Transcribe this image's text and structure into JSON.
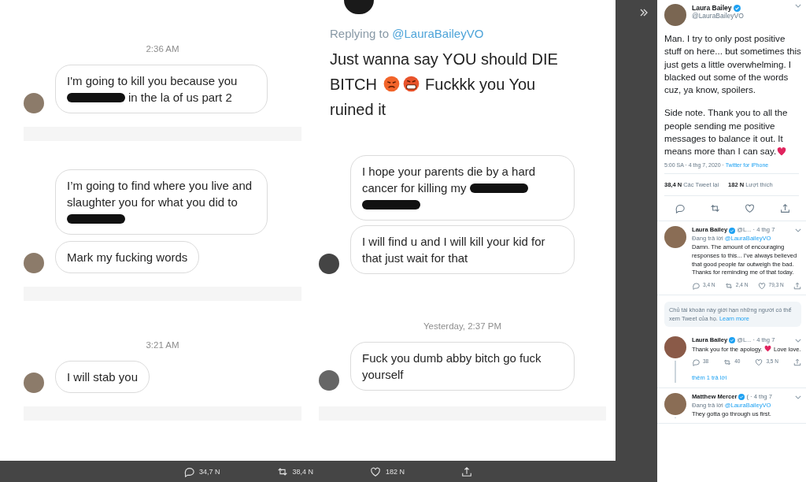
{
  "image": {
    "left_thread": [
      {
        "kind": "time",
        "text": "2:36 AM"
      },
      {
        "kind": "message",
        "avatar": true,
        "segments": [
          {
            "kind": "text",
            "text": "I'm going to kill you because you "
          },
          {
            "kind": "redacted"
          },
          {
            "kind": "text",
            "text": "in the la of us part 2"
          }
        ]
      },
      {
        "kind": "divider"
      },
      {
        "kind": "message",
        "avatar": false,
        "segments": [
          {
            "kind": "text",
            "text": "I’m going to find where you live and slaughter you for what you did to "
          },
          {
            "kind": "redacted"
          }
        ]
      },
      {
        "kind": "message",
        "avatar": true,
        "segments": [
          {
            "kind": "text",
            "text": "Mark my fucking words"
          }
        ]
      },
      {
        "kind": "divider"
      },
      {
        "kind": "time",
        "text": "3:21 AM"
      },
      {
        "kind": "message",
        "avatar": true,
        "segments": [
          {
            "kind": "text",
            "text": "I will stab you"
          }
        ]
      },
      {
        "kind": "divider"
      }
    ],
    "right_thread": [
      {
        "kind": "reply_header",
        "prefix": "Replying to",
        "handle": "@LauraBaileyVO"
      },
      {
        "kind": "tweet_text",
        "segments": [
          {
            "kind": "text",
            "text": "Just wanna say YOU should DIE BITCH "
          },
          {
            "kind": "angry-emoji"
          },
          {
            "kind": "cursing-emoji"
          },
          {
            "kind": "text",
            "text": " Fuckkk you You ruined it"
          }
        ]
      },
      {
        "kind": "message",
        "avatar": false,
        "segments": [
          {
            "kind": "text",
            "text": "I hope your parents die by a hard cancer for killing my "
          },
          {
            "kind": "redacted"
          },
          {
            "kind": "redacted"
          }
        ]
      },
      {
        "kind": "message",
        "avatar": true,
        "segments": [
          {
            "kind": "text",
            "text": "I will find u and I will kill your kid for that just wait for that"
          }
        ]
      },
      {
        "kind": "time",
        "text": "Yesterday, 2:37 PM"
      },
      {
        "kind": "message",
        "avatar": true,
        "segments": [
          {
            "kind": "text",
            "text": "Fuck you dumb abby bitch go fuck yourself"
          }
        ]
      },
      {
        "kind": "divider"
      }
    ]
  },
  "action_bar": [
    {
      "kind": "reply",
      "count": "34,7 N"
    },
    {
      "kind": "retweet",
      "count": "38,4 N"
    },
    {
      "kind": "like",
      "count": "182 N"
    },
    {
      "kind": "share"
    }
  ],
  "side_panel": {
    "main_tweet": {
      "name": "Laura Bailey",
      "verified": true,
      "handle": "@LauraBaileyVO",
      "segments": [
        {
          "kind": "text",
          "text": "Man. I try to only post positive stuff on here... but sometimes this just gets a little overwhelming. I blacked out some of the words cuz, ya know, spoilers."
        },
        {
          "kind": "break"
        },
        {
          "kind": "text",
          "text": "Side note. Thank you to all the people sending me positive messages to balance it out. It means more than I can say."
        },
        {
          "kind": "heart-emoji"
        }
      ],
      "meta": "5:00 SA · 4 thg 7, 2020 · ",
      "source": "Twitter for iPhone",
      "stats": [
        {
          "count": "38,4 N",
          "label": "Các Tweet lại"
        },
        {
          "count": "182 N",
          "label": "Lượt thích"
        }
      ]
    },
    "replies": [
      {
        "kind": "reply",
        "name": "Laura Bailey",
        "verified": true,
        "handle": "@L...",
        "date": "· 4 thg 7",
        "replying_prefix": "Đang trả lời",
        "replying_handle": "@LauraBaileyVO",
        "thread_line": false,
        "segments": [
          {
            "kind": "text",
            "text": "Damn. The amount of encouraging responses to this... I've always believed that good people far outweigh the bad. Thanks for reminding me of that today."
          }
        ],
        "counts": [
          "3,4 N",
          "2,4 N",
          "79,3 N"
        ]
      },
      {
        "kind": "notice",
        "text": "Chủ tài khoản này giới hạn những người có thể xem Tweet của họ.",
        "link": "Learn more"
      },
      {
        "kind": "reply",
        "name": "Laura Bailey",
        "verified": true,
        "handle": "@L...",
        "date": "· 4 thg 7",
        "thread_line": true,
        "segments": [
          {
            "kind": "text",
            "text": "Thank you for the apology. "
          },
          {
            "kind": "heart-emoji"
          },
          {
            "kind": "text",
            "text": " Love love."
          }
        ],
        "counts": [
          "38",
          "40",
          "3,5 N"
        ],
        "more": "thêm 1 trả lời"
      },
      {
        "kind": "reply",
        "name": "Matthew Mercer",
        "verified": true,
        "handle": "(",
        "date": "· 4 thg 7",
        "replying_prefix": "Đang trả lời",
        "replying_handle": "@LauraBaileyVO",
        "thread_line": true,
        "segments": [
          {
            "kind": "text",
            "text": "They gotta go through us first."
          }
        ]
      }
    ]
  }
}
